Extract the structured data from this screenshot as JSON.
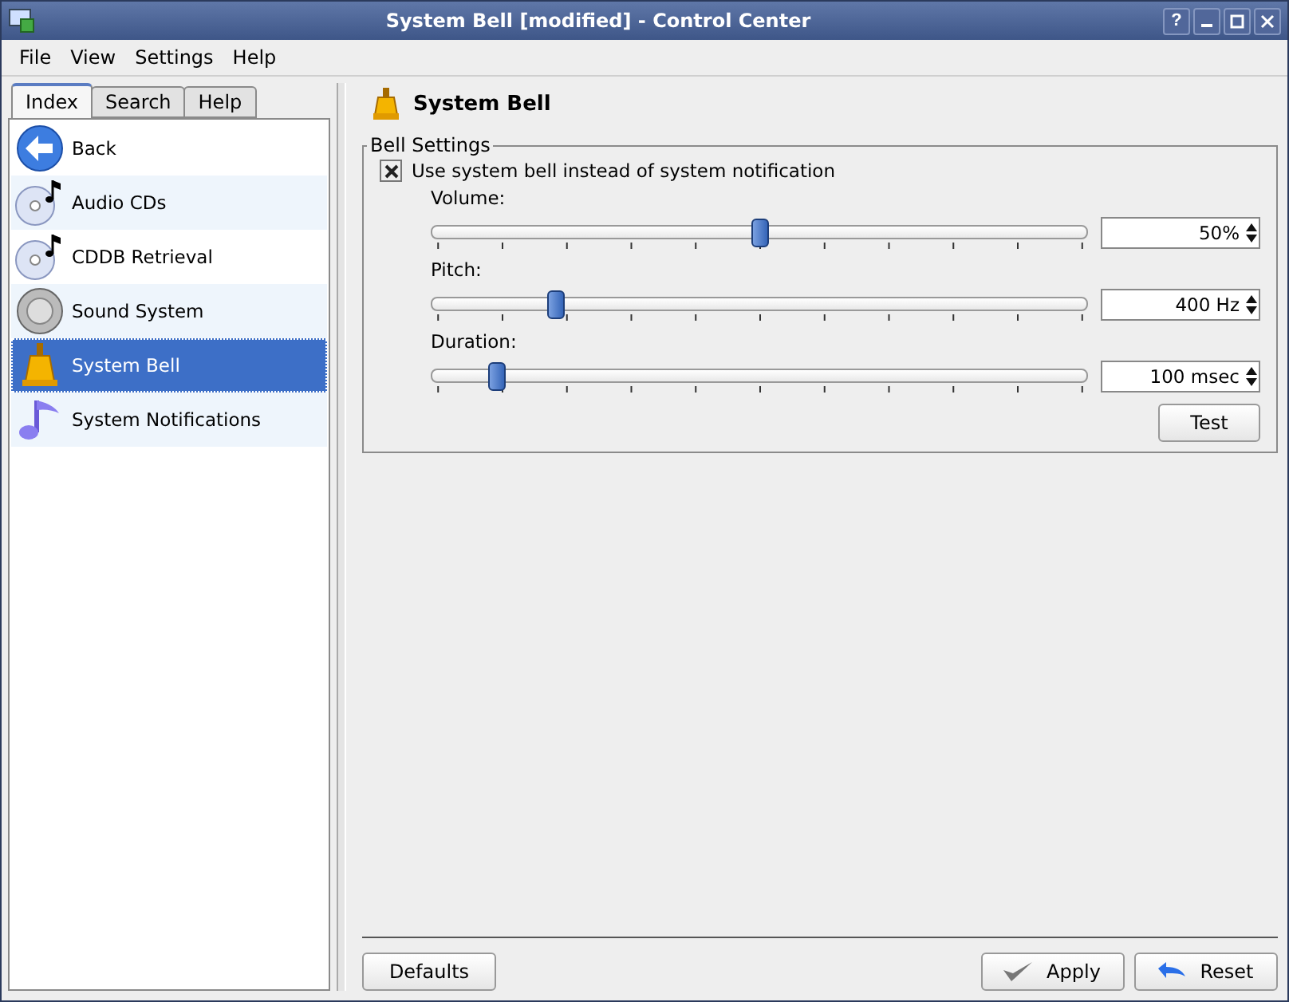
{
  "window": {
    "title": "System Bell [modified] - Control Center",
    "buttons": [
      {
        "kind": "help",
        "label": "?"
      },
      {
        "kind": "minimize"
      },
      {
        "kind": "maximize"
      },
      {
        "kind": "close"
      }
    ]
  },
  "menu": [
    "File",
    "View",
    "Settings",
    "Help"
  ],
  "tabs": [
    {
      "label": "Index",
      "selected": true
    },
    {
      "label": "Search",
      "selected": false
    },
    {
      "label": "Help",
      "selected": false
    }
  ],
  "sidebar": {
    "items": [
      {
        "label": "Back",
        "kind": "back",
        "selected": false
      },
      {
        "label": "Audio CDs",
        "kind": "cd",
        "selected": false
      },
      {
        "label": "CDDB Retrieval",
        "kind": "cd",
        "selected": false
      },
      {
        "label": "Sound System",
        "kind": "speaker",
        "selected": false
      },
      {
        "label": "System Bell",
        "kind": "bell",
        "selected": true
      },
      {
        "label": "System Notifications",
        "kind": "note",
        "selected": false
      }
    ]
  },
  "page": {
    "title": "System Bell",
    "group": {
      "title": "Bell Settings",
      "checkbox": {
        "label": "Use system bell instead of system notification",
        "checked": true
      },
      "sliders": [
        {
          "label": "Volume:",
          "level": 0.5,
          "value": "50%"
        },
        {
          "label": "Pitch:",
          "level": 0.19,
          "value": "400 Hz"
        },
        {
          "label": "Duration:",
          "level": 0.1,
          "value": "100 msec"
        }
      ],
      "test_button": "Test"
    }
  },
  "footer": {
    "defaults": "Defaults",
    "apply": "Apply",
    "reset": "Reset"
  }
}
